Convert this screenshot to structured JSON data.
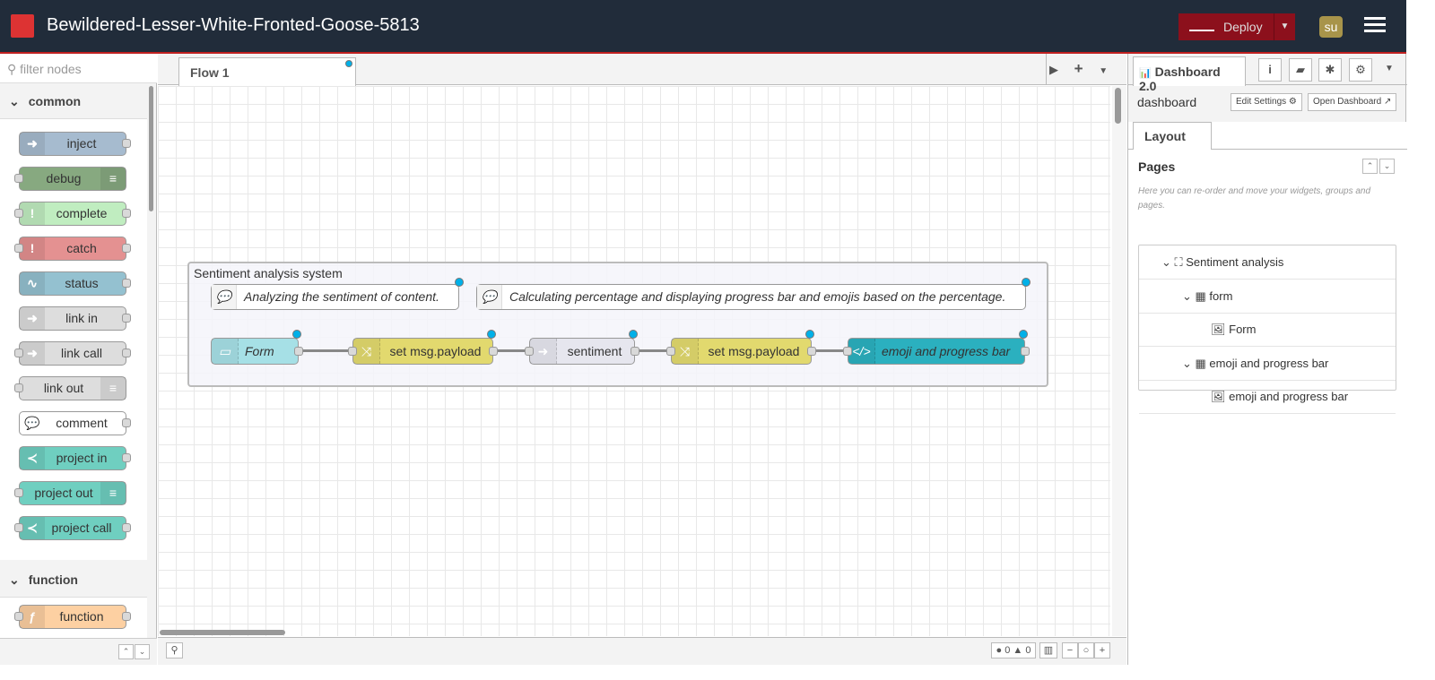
{
  "header": {
    "title": "Bewildered-Lesser-White-Fronted-Goose-5813",
    "deploy_label": "Deploy",
    "avatar": "su"
  },
  "palette": {
    "filter_placeholder": "filter nodes",
    "categories": [
      {
        "name": "common",
        "nodes": [
          {
            "label": "inject",
            "color": "#a6bbcf"
          },
          {
            "label": "debug",
            "color": "#87a980"
          },
          {
            "label": "complete",
            "color": "#c0edc0"
          },
          {
            "label": "catch",
            "color": "#e49191"
          },
          {
            "label": "status",
            "color": "#94c1d0"
          },
          {
            "label": "link in",
            "color": "#dddddd"
          },
          {
            "label": "link call",
            "color": "#dddddd"
          },
          {
            "label": "link out",
            "color": "#dddddd"
          },
          {
            "label": "comment",
            "color": "#ffffff"
          },
          {
            "label": "project in",
            "color": "#6fcfc0"
          },
          {
            "label": "project out",
            "color": "#6fcfc0"
          },
          {
            "label": "project call",
            "color": "#6fcfc0"
          }
        ]
      },
      {
        "name": "function",
        "nodes": [
          {
            "label": "function",
            "color": "#fdd0a2"
          }
        ]
      }
    ]
  },
  "workspace": {
    "tab": "Flow 1",
    "group": {
      "label": "Sentiment analysis system"
    },
    "comments": [
      "Analyzing the sentiment of content.",
      "Calculating percentage and displaying progress bar and emojis based on the percentage."
    ],
    "nodes": [
      {
        "label": "Form",
        "color": "#a6e0e6"
      },
      {
        "label": "set msg.payload",
        "color": "#e2d96e"
      },
      {
        "label": "sentiment",
        "color": "#e6e6ee"
      },
      {
        "label": "set msg.payload",
        "color": "#e2d96e"
      },
      {
        "label": "emoji and progress bar",
        "color": "#2bb0bf"
      }
    ],
    "footer": {
      "errors": "0",
      "warnings": "0"
    }
  },
  "sidebar": {
    "tab": "Dashboard 2.0",
    "dashboard_label": "dashboard",
    "edit_settings": "Edit Settings",
    "open_dashboard": "Open Dashboard",
    "layout_tab": "Layout",
    "pages_title": "Pages",
    "hint": "Here you can re-order and move your widgets, groups and pages.",
    "tree": [
      {
        "label": "Sentiment analysis",
        "type": "page"
      },
      {
        "label": "form",
        "type": "group"
      },
      {
        "label": "Form",
        "type": "widget"
      },
      {
        "label": "emoji and progress bar",
        "type": "group"
      },
      {
        "label": "emoji and progress bar",
        "type": "widget"
      }
    ]
  }
}
